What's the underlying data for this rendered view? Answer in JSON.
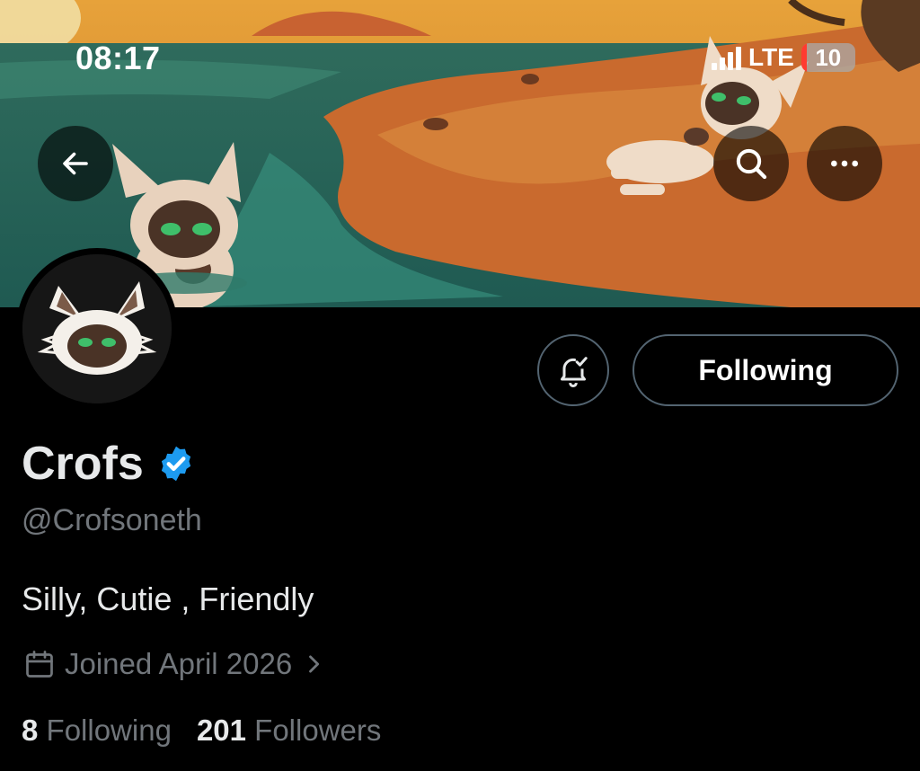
{
  "status_bar": {
    "time": "08:17",
    "network": "LTE",
    "battery_level": "10",
    "battery_color": "#ff3b30",
    "battery_fraction": 0.1
  },
  "header": {
    "back_icon": "arrow-left-icon",
    "search_icon": "search-icon",
    "more_icon": "more-horizontal-icon"
  },
  "profile": {
    "name": "Crofs",
    "verified_icon": "verified-badge-icon",
    "verified_color": "#1d9bf0",
    "handle": "@Crofsoneth",
    "bio": "Silly, Cutie , Friendly",
    "joined": "Joined April 2026",
    "joined_icon": "calendar-icon"
  },
  "actions": {
    "notify_icon": "bell-check-icon",
    "follow_label": "Following"
  },
  "stats": {
    "following_count": "8",
    "following_label": "Following",
    "followers_count": "201",
    "followers_label": "Followers"
  },
  "colors": {
    "background": "#000000",
    "text": "#e7e9ea",
    "secondary": "#71767b",
    "border": "#536471"
  }
}
